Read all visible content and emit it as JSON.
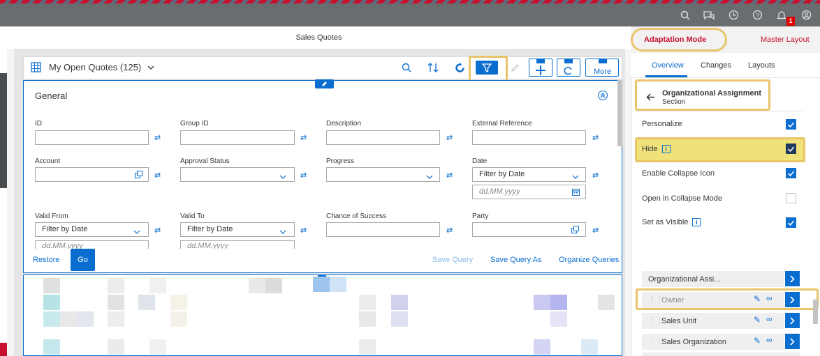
{
  "shell": {
    "notification_count": "1",
    "icons": [
      "search-icon",
      "chat-icon",
      "history-icon",
      "help-icon",
      "bell-icon",
      "user-icon"
    ]
  },
  "page": {
    "title": "Sales Quotes"
  },
  "toolbar": {
    "variant": "My Open Quotes (125)",
    "more_label": "More"
  },
  "filter": {
    "section_title": "General",
    "fields": [
      {
        "label": "ID",
        "value": ""
      },
      {
        "label": "Group ID",
        "value": ""
      },
      {
        "label": "Description",
        "value": ""
      },
      {
        "label": "External Reference",
        "value": ""
      },
      {
        "label": "Account",
        "value": ""
      },
      {
        "label": "Approval Status",
        "value": ""
      },
      {
        "label": "Progress",
        "value": ""
      },
      {
        "label": "Date",
        "value": "Filter by Date",
        "placeholder": "dd.MM.yyyy"
      },
      {
        "label": "Valid From",
        "value": "Filter by Date",
        "placeholder": "dd.MM.yyyy"
      },
      {
        "label": "Valid To",
        "value": "Filter by Date",
        "placeholder": "dd.MM.yyyy"
      },
      {
        "label": "Chance of Success",
        "value": ""
      },
      {
        "label": "Party",
        "value": ""
      }
    ],
    "restore": "Restore",
    "go": "Go",
    "save_query": "Save Query",
    "save_query_as": "Save Query As",
    "organize_queries": "Organize Queries"
  },
  "panel": {
    "mode": "Adaptation Mode",
    "master_layout": "Master Layout",
    "tabs": [
      "Overview",
      "Changes",
      "Layouts"
    ],
    "section_title": "Organizational Assignment",
    "section_sub": "Section",
    "props": [
      {
        "label": "Personalize",
        "checked": true
      },
      {
        "label": "Hide",
        "checked": true,
        "info": true
      },
      {
        "label": "Enable Collapse Icon",
        "checked": true
      },
      {
        "label": "Open in Collapse Mode",
        "checked": false
      },
      {
        "label": "Set as Visible",
        "checked": true,
        "info": true
      }
    ],
    "sections": [
      "Organizational Assi...",
      "Owner",
      "Sales Unit",
      "Sales Organization"
    ]
  },
  "colors": {
    "accent": "#0a6ed1",
    "brand_red": "#c8102e",
    "highlight": "#f0e27a"
  }
}
